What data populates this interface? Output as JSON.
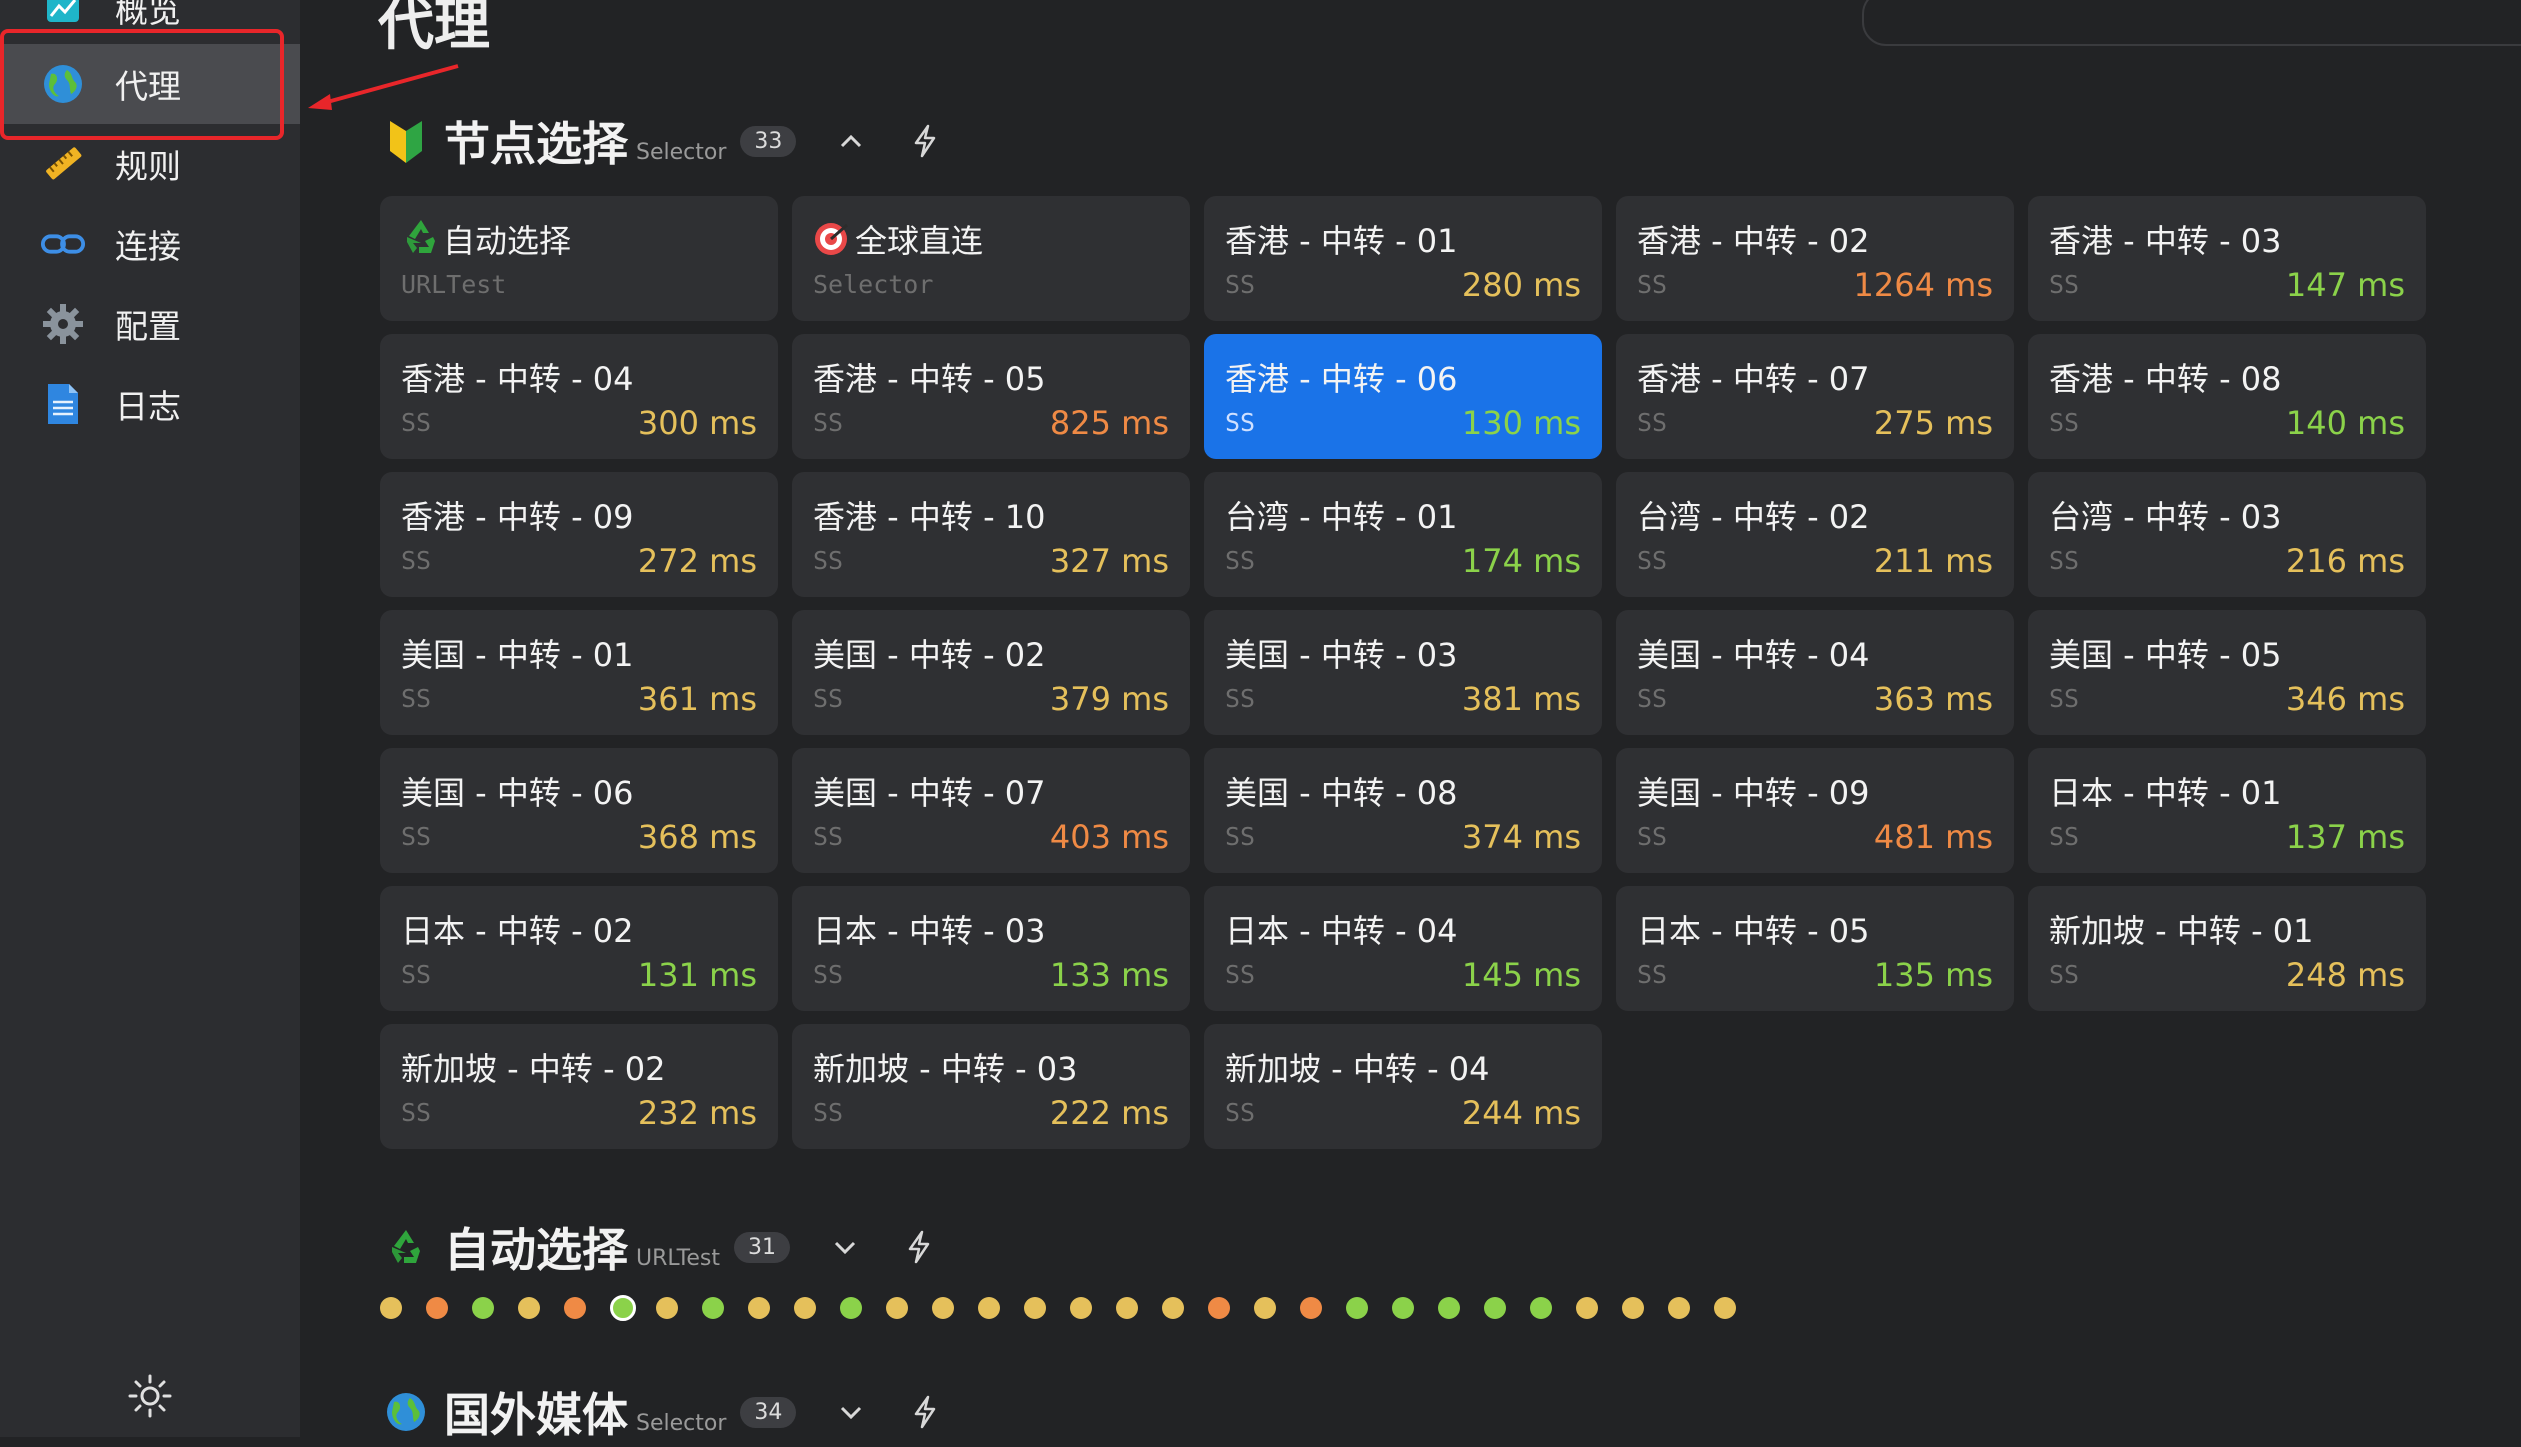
{
  "sidebar": {
    "items": [
      {
        "label": "概览",
        "icon": "overview-icon"
      },
      {
        "label": "代理",
        "icon": "globe-icon"
      },
      {
        "label": "规则",
        "icon": "ruler-icon"
      },
      {
        "label": "连接",
        "icon": "link-icon"
      },
      {
        "label": "配置",
        "icon": "gear-icon"
      },
      {
        "label": "日志",
        "icon": "document-icon"
      }
    ],
    "active_index": 1,
    "theme_toggle_icon": "sun-icon"
  },
  "page": {
    "title": "代理"
  },
  "groups": [
    {
      "name": "节点选择",
      "type": "Selector",
      "count": "33",
      "icon": "beginner-shield-icon",
      "expanded": true
    },
    {
      "name": "自动选择",
      "type": "URLTest",
      "count": "31",
      "icon": "recycle-icon",
      "expanded": false
    },
    {
      "name": "国外媒体",
      "type": "Selector",
      "count": "34",
      "icon": "globe-icon",
      "expanded": false
    }
  ],
  "colors": {
    "good": "#8bd24a",
    "medium": "#e5c05b",
    "slow": "#ef8a45",
    "selected": "#1a73e8"
  },
  "proxies": [
    {
      "name": "自动选择",
      "type": "URLTest",
      "delay": "",
      "level": "",
      "icon": "recycle-icon"
    },
    {
      "name": "全球直连",
      "type": "Selector",
      "delay": "",
      "level": "",
      "icon": "target-icon"
    },
    {
      "name": "香港 - 中转 - 01",
      "type": "SS",
      "delay": "280 ms",
      "level": "medium"
    },
    {
      "name": "香港 - 中转 - 02",
      "type": "SS",
      "delay": "1264 ms",
      "level": "slow"
    },
    {
      "name": "香港 - 中转 - 03",
      "type": "SS",
      "delay": "147 ms",
      "level": "good"
    },
    {
      "name": "香港 - 中转 - 04",
      "type": "SS",
      "delay": "300 ms",
      "level": "medium"
    },
    {
      "name": "香港 - 中转 - 05",
      "type": "SS",
      "delay": "825 ms",
      "level": "slow"
    },
    {
      "name": "香港 - 中转 - 06",
      "type": "SS",
      "delay": "130 ms",
      "level": "good",
      "selected": true
    },
    {
      "name": "香港 - 中转 - 07",
      "type": "SS",
      "delay": "275 ms",
      "level": "medium"
    },
    {
      "name": "香港 - 中转 - 08",
      "type": "SS",
      "delay": "140 ms",
      "level": "good"
    },
    {
      "name": "香港 - 中转 - 09",
      "type": "SS",
      "delay": "272 ms",
      "level": "medium"
    },
    {
      "name": "香港 - 中转 - 10",
      "type": "SS",
      "delay": "327 ms",
      "level": "medium"
    },
    {
      "name": "台湾 - 中转 - 01",
      "type": "SS",
      "delay": "174 ms",
      "level": "good"
    },
    {
      "name": "台湾 - 中转 - 02",
      "type": "SS",
      "delay": "211 ms",
      "level": "medium"
    },
    {
      "name": "台湾 - 中转 - 03",
      "type": "SS",
      "delay": "216 ms",
      "level": "medium"
    },
    {
      "name": "美国 - 中转 - 01",
      "type": "SS",
      "delay": "361 ms",
      "level": "medium"
    },
    {
      "name": "美国 - 中转 - 02",
      "type": "SS",
      "delay": "379 ms",
      "level": "medium"
    },
    {
      "name": "美国 - 中转 - 03",
      "type": "SS",
      "delay": "381 ms",
      "level": "medium"
    },
    {
      "name": "美国 - 中转 - 04",
      "type": "SS",
      "delay": "363 ms",
      "level": "medium"
    },
    {
      "name": "美国 - 中转 - 05",
      "type": "SS",
      "delay": "346 ms",
      "level": "medium"
    },
    {
      "name": "美国 - 中转 - 06",
      "type": "SS",
      "delay": "368 ms",
      "level": "medium"
    },
    {
      "name": "美国 - 中转 - 07",
      "type": "SS",
      "delay": "403 ms",
      "level": "slow"
    },
    {
      "name": "美国 - 中转 - 08",
      "type": "SS",
      "delay": "374 ms",
      "level": "medium"
    },
    {
      "name": "美国 - 中转 - 09",
      "type": "SS",
      "delay": "481 ms",
      "level": "slow"
    },
    {
      "name": "日本 - 中转 - 01",
      "type": "SS",
      "delay": "137 ms",
      "level": "good"
    },
    {
      "name": "日本 - 中转 - 02",
      "type": "SS",
      "delay": "131 ms",
      "level": "good"
    },
    {
      "name": "日本 - 中转 - 03",
      "type": "SS",
      "delay": "133 ms",
      "level": "good"
    },
    {
      "name": "日本 - 中转 - 04",
      "type": "SS",
      "delay": "145 ms",
      "level": "good"
    },
    {
      "name": "日本 - 中转 - 05",
      "type": "SS",
      "delay": "135 ms",
      "level": "good"
    },
    {
      "name": "新加坡 - 中转 - 01",
      "type": "SS",
      "delay": "248 ms",
      "level": "medium"
    },
    {
      "name": "新加坡 - 中转 - 02",
      "type": "SS",
      "delay": "232 ms",
      "level": "medium"
    },
    {
      "name": "新加坡 - 中转 - 03",
      "type": "SS",
      "delay": "222 ms",
      "level": "medium"
    },
    {
      "name": "新加坡 - 中转 - 04",
      "type": "SS",
      "delay": "244 ms",
      "level": "medium"
    }
  ],
  "auto_select_dots": [
    "medium",
    "slow",
    "good",
    "medium",
    "slow",
    "good-current",
    "medium",
    "good",
    "medium",
    "medium",
    "good",
    "medium",
    "medium",
    "medium",
    "medium",
    "medium",
    "medium",
    "medium",
    "slow",
    "medium",
    "slow",
    "good",
    "good",
    "good",
    "good",
    "good",
    "medium",
    "medium",
    "medium",
    "medium"
  ]
}
